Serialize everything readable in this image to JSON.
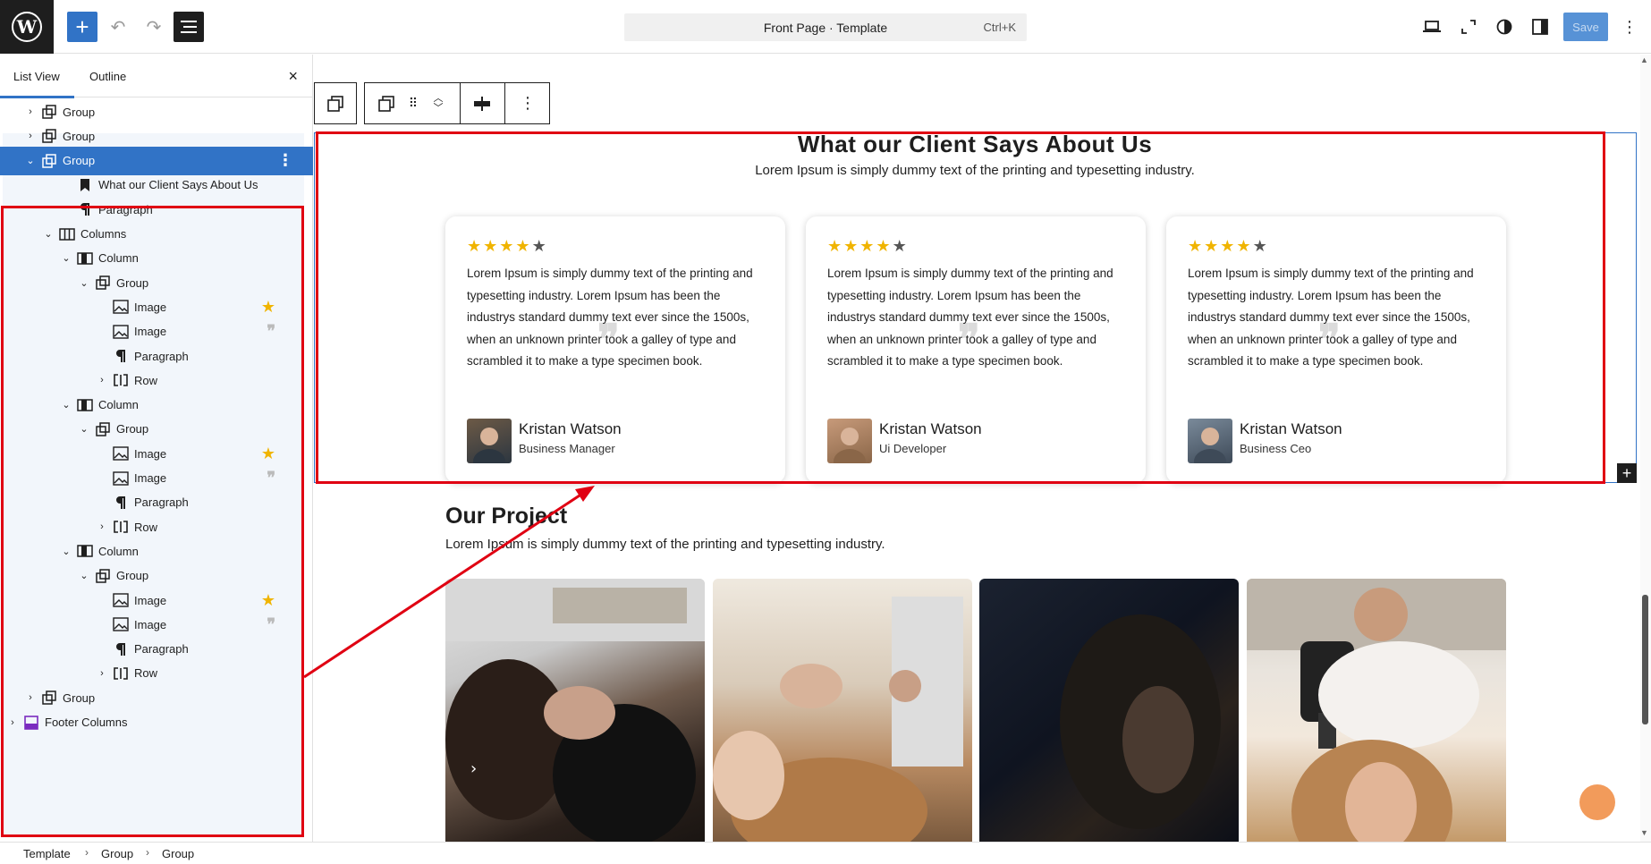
{
  "topbar": {
    "logo": "W",
    "command_title": "Front Page · Template",
    "command_shortcut": "Ctrl+K",
    "save_label": "Save"
  },
  "sidebar": {
    "tabs": [
      "List View",
      "Outline"
    ],
    "close": "×",
    "items": [
      {
        "label": "Group",
        "icon": "group-icon"
      },
      {
        "label": "Group",
        "icon": "group-icon"
      },
      {
        "label": "Group",
        "icon": "group-icon"
      },
      {
        "label": "What our Client Says About Us",
        "icon": "bookmark-icon"
      },
      {
        "label": "Paragraph",
        "icon": "paragraph-icon"
      },
      {
        "label": "Columns",
        "icon": "columns-icon"
      },
      {
        "label": "Column",
        "icon": "column-icon"
      },
      {
        "label": "Group",
        "icon": "group-icon"
      },
      {
        "label": "Image",
        "icon": "image-icon"
      },
      {
        "label": "Image",
        "icon": "image-icon"
      },
      {
        "label": "Paragraph",
        "icon": "paragraph-icon"
      },
      {
        "label": "Row",
        "icon": "row-icon"
      },
      {
        "label": "Column",
        "icon": "column-icon"
      },
      {
        "label": "Group",
        "icon": "group-icon"
      },
      {
        "label": "Image",
        "icon": "image-icon"
      },
      {
        "label": "Image",
        "icon": "image-icon"
      },
      {
        "label": "Paragraph",
        "icon": "paragraph-icon"
      },
      {
        "label": "Row",
        "icon": "row-icon"
      },
      {
        "label": "Column",
        "icon": "column-icon"
      },
      {
        "label": "Group",
        "icon": "group-icon"
      },
      {
        "label": "Image",
        "icon": "image-icon"
      },
      {
        "label": "Image",
        "icon": "image-icon"
      },
      {
        "label": "Paragraph",
        "icon": "paragraph-icon"
      },
      {
        "label": "Row",
        "icon": "row-icon"
      },
      {
        "label": "Group",
        "icon": "group-icon"
      },
      {
        "label": "Footer Columns",
        "icon": "template-part-icon"
      }
    ]
  },
  "canvas": {
    "testimonials": {
      "title": "What our Client Says About Us",
      "subtitle": "Lorem Ipsum is simply dummy text of the printing and typesetting industry.",
      "rating": 4,
      "rating_max": 5,
      "cards": [
        {
          "text": "Lorem Ipsum is simply dummy text of the printing and typesetting industry. Lorem Ipsum has been the industrys standard dummy text ever since the 1500s, when an unknown printer took a galley of type and scrambled it to make a type specimen book.",
          "name": "Kristan Watson",
          "role": "Business Manager"
        },
        {
          "text": "Lorem Ipsum is simply dummy text of the printing and typesetting industry. Lorem Ipsum has been the industrys standard dummy text ever since the 1500s, when an unknown printer took a galley of type and scrambled it to make a type specimen book.",
          "name": "Kristan Watson",
          "role": "Ui Developer"
        },
        {
          "text": "Lorem Ipsum is simply dummy text of the printing and typesetting industry. Lorem Ipsum has been the industrys standard dummy text ever since the 1500s, when an unknown printer took a galley of type and scrambled it to make a type specimen book.",
          "name": "Kristan Watson",
          "role": "Business Ceo"
        }
      ]
    },
    "project": {
      "title": "Our Project",
      "subtitle": "Lorem Ipsum is simply dummy text of the printing and typesetting industry."
    }
  },
  "breadcrumb": [
    "Template",
    "Group",
    "Group"
  ],
  "colors": {
    "accent": "#3173c6",
    "highlight_red": "#e00012",
    "star": "#f0b400",
    "fab": "#f29b5b"
  }
}
